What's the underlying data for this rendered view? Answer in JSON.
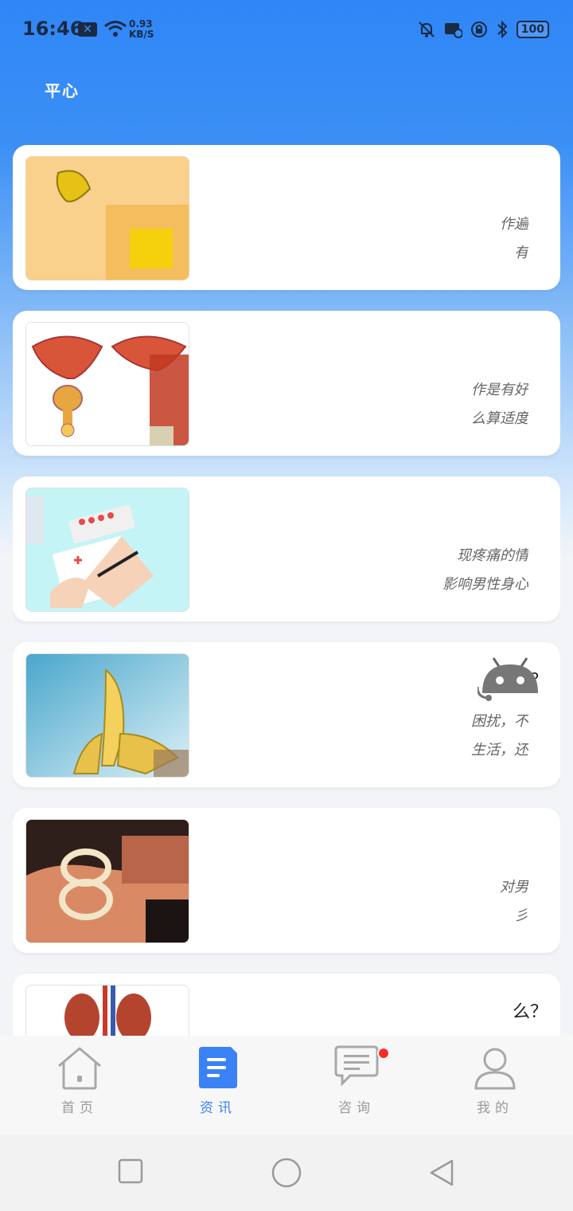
{
  "status_bar": {
    "time": "16:46",
    "net_speed_value": "0.93",
    "net_speed_unit": "KB/S",
    "battery": "100"
  },
  "header": {
    "title": "平心"
  },
  "articles": [
    {
      "title": "",
      "desc_line1": "作遍",
      "desc_line2": "有",
      "image": "lemon-fruit"
    },
    {
      "title": "",
      "desc_line1": "作是有好",
      "desc_line2": "么算适度",
      "image": "prostate-diagram"
    },
    {
      "title": "",
      "desc_line1": "现疼痛的情",
      "desc_line2": "影响男性身心",
      "image": "pills-and-prescription"
    },
    {
      "title": "些？",
      "desc_line1": "困扰，不",
      "desc_line2": "生活，还",
      "image": "banana"
    },
    {
      "title": "",
      "desc_line1": "对男",
      "desc_line2": "彡",
      "image": "condom-in-hand"
    },
    {
      "title": "么？",
      "desc_line1": "",
      "desc_line2": "",
      "image": "kidneys-diagram"
    }
  ],
  "tabs": [
    {
      "label": "首页",
      "icon": "home-icon"
    },
    {
      "label": "资讯",
      "icon": "news-document-icon"
    },
    {
      "label": "咨询",
      "icon": "chat-bubble-icon"
    },
    {
      "label": "我的",
      "icon": "user-profile-icon"
    }
  ],
  "active_tab": "资讯",
  "colors": {
    "accent": "#3b82f6",
    "header_blue": "#2f86f6",
    "badge_red": "#ff2a2a"
  }
}
